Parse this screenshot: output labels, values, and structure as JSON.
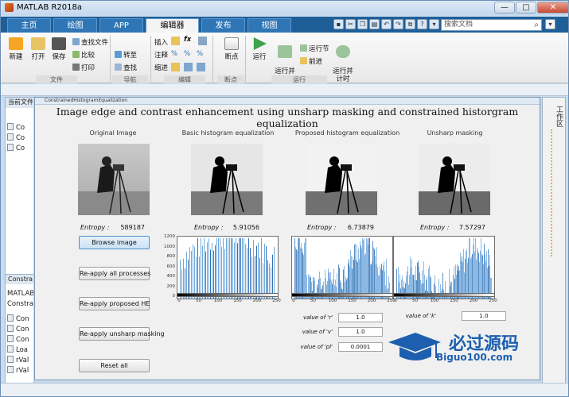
{
  "app": {
    "title": "MATLAB R2018a",
    "minimize": "—",
    "maximize": "□",
    "close": "✕"
  },
  "tabs": [
    {
      "label": "主页"
    },
    {
      "label": "绘图"
    },
    {
      "label": "APP"
    },
    {
      "label": "编辑器"
    },
    {
      "label": "发布"
    },
    {
      "label": "视图"
    }
  ],
  "search": {
    "placeholder": "搜索文档"
  },
  "ribbon": {
    "new": "新建",
    "open": "打开",
    "save": "保存",
    "find_files": "查找文件",
    "compare": "比较",
    "print": "打印",
    "goto": "转至",
    "find": "查找",
    "insert": "插入",
    "comment": "注释",
    "indent": "缩进",
    "breakpoints": "断点",
    "run": "运行",
    "run_advance": "运行并\n前进",
    "run_section": "运行节",
    "advance": "前进",
    "run_time": "运行并\n计时",
    "groups": {
      "file": "文件",
      "nav": "导航",
      "edit": "编辑",
      "bp": "断点",
      "run": "运行"
    }
  },
  "left_panel": {
    "header": "当前文件",
    "rows": [
      "Co",
      "Co",
      "Co"
    ],
    "section2": "Constra",
    "info1": "MATLAB",
    "info2": "Constra",
    "vars": [
      "Con",
      "Con",
      "Con",
      "Loa",
      "rVal",
      "rVal"
    ]
  },
  "right_panel": {
    "label": "工作区"
  },
  "figure": {
    "window_title": "ConstrainedHistogramEqualization",
    "heading": "Image edge and contrast enhancement using unsharp masking and constrained historgram equalization",
    "panels": [
      {
        "caption": "Original Image",
        "entropy_label": "Entropy :",
        "entropy": "589187"
      },
      {
        "caption": "Basic histogram equalization",
        "entropy_label": "Entropy :",
        "entropy": "5.91056"
      },
      {
        "caption": "Proposed histogram equalization",
        "entropy_label": "Entropy :",
        "entropy": "6.73879"
      },
      {
        "caption": "Unsharp masking",
        "entropy_label": "Entropy :",
        "entropy": "7.57297"
      }
    ],
    "buttons": [
      "Browse image",
      "Re-apply all processes",
      "Re-apply proposed HE",
      "Re-apply unsharp masking",
      "Reset all"
    ],
    "hist_yticks": [
      [
        "1200",
        "1000",
        "800",
        "600",
        "400",
        "200",
        "0"
      ],
      [
        "",
        "",
        "",
        "",
        "",
        "",
        ""
      ],
      [
        "",
        "",
        "",
        "",
        "",
        "",
        ""
      ]
    ],
    "hist_xticks": [
      "0",
      "50",
      "100",
      "150",
      "200",
      "250"
    ],
    "params": [
      {
        "label": "value of 'r'",
        "value": "1.0"
      },
      {
        "label": "value of 'v'",
        "value": "1.0"
      },
      {
        "label": "value of 'pl'",
        "value": "0.0001"
      },
      {
        "label": "value of 'k'",
        "value": "1.0"
      }
    ]
  },
  "watermark": {
    "cn": "必过源码",
    "url": "Biguo100.com"
  },
  "colors": {
    "accent": "#1f5f98",
    "hist_bar": "#6fa8dc",
    "hist_bar_dark": "#2f6fb5"
  }
}
